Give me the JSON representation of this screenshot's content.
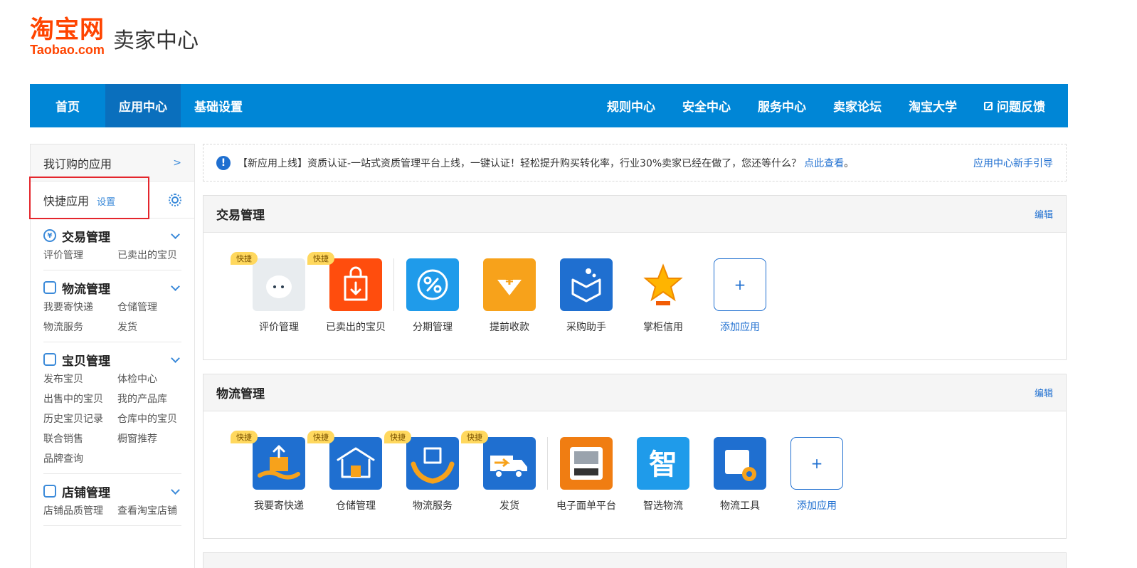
{
  "header": {
    "logo_cn": "淘宝网",
    "logo_en": "Taobao.com",
    "subtitle": "卖家中心"
  },
  "nav": {
    "left": [
      "首页",
      "应用中心",
      "基础设置"
    ],
    "right": [
      "规则中心",
      "安全中心",
      "服务中心",
      "卖家论坛",
      "淘宝大学",
      "问题反馈"
    ],
    "active": "应用中心"
  },
  "sidebar": {
    "my_apps": "我订购的应用",
    "quick_apps": "快捷应用",
    "quick_set": "设置",
    "groups": [
      {
        "title": "交易管理",
        "icon": "yen-icon",
        "links": [
          "评价管理",
          "已卖出的宝贝"
        ]
      },
      {
        "title": "物流管理",
        "icon": "truck-icon",
        "links": [
          "我要寄快递",
          "仓储管理",
          "物流服务",
          "发货"
        ]
      },
      {
        "title": "宝贝管理",
        "icon": "bag-icon",
        "links": [
          "发布宝贝",
          "体检中心",
          "出售中的宝贝",
          "我的产品库",
          "历史宝贝记录",
          "仓库中的宝贝",
          "联合销售",
          "橱窗推荐",
          "品牌查询"
        ]
      },
      {
        "title": "店铺管理",
        "icon": "shop-icon",
        "links": [
          "店铺品质管理",
          "查看淘宝店铺"
        ]
      }
    ]
  },
  "notice": {
    "text": "【新应用上线】资质认证-一站式资质管理平台上线，一键认证！轻松提升购买转化率，行业30%卖家已经在做了，您还等什么？",
    "link": "点此查看",
    "tail": "。",
    "guide": "应用中心新手引导"
  },
  "panels": [
    {
      "title": "交易管理",
      "edit": "编辑",
      "apps": [
        {
          "label": "评价管理",
          "badge": "快捷",
          "icon": "review-icon",
          "color": "#e8ecef"
        },
        {
          "label": "已卖出的宝贝",
          "badge": "快捷",
          "icon": "sold-bag-icon",
          "color": "#ff4d0d",
          "divider": true
        },
        {
          "label": "分期管理",
          "badge": "",
          "icon": "percent-icon",
          "color": "#1f9bea"
        },
        {
          "label": "提前收款",
          "badge": "",
          "icon": "yen-down-icon",
          "color": "#f7a21b"
        },
        {
          "label": "采购助手",
          "badge": "",
          "icon": "purchase-box-icon",
          "color": "#1f6fd0"
        },
        {
          "label": "掌柜信用",
          "badge": "",
          "icon": "star-trophy-icon",
          "color": "#ffffff"
        },
        {
          "label": "添加应用",
          "badge": "",
          "icon": "plus-icon",
          "color": "add"
        }
      ]
    },
    {
      "title": "物流管理",
      "edit": "编辑",
      "apps": [
        {
          "label": "我要寄快递",
          "badge": "快捷",
          "icon": "send-parcel-icon",
          "color": "#1f6fd0"
        },
        {
          "label": "仓储管理",
          "badge": "快捷",
          "icon": "warehouse-icon",
          "color": "#1f6fd0"
        },
        {
          "label": "物流服务",
          "badge": "快捷",
          "icon": "hands-box-icon",
          "color": "#1f6fd0"
        },
        {
          "label": "发货",
          "badge": "快捷",
          "icon": "delivery-truck-icon",
          "color": "#1f6fd0",
          "divider": true
        },
        {
          "label": "电子面单平台",
          "badge": "",
          "icon": "printer-icon",
          "color": "#f07d12"
        },
        {
          "label": "智选物流",
          "badge": "",
          "icon": "smart-logistics-icon",
          "color": "#1f9bea"
        },
        {
          "label": "物流工具",
          "badge": "",
          "icon": "box-gear-icon",
          "color": "#1f6fd0"
        },
        {
          "label": "添加应用",
          "badge": "",
          "icon": "plus-icon",
          "color": "add"
        }
      ]
    }
  ]
}
